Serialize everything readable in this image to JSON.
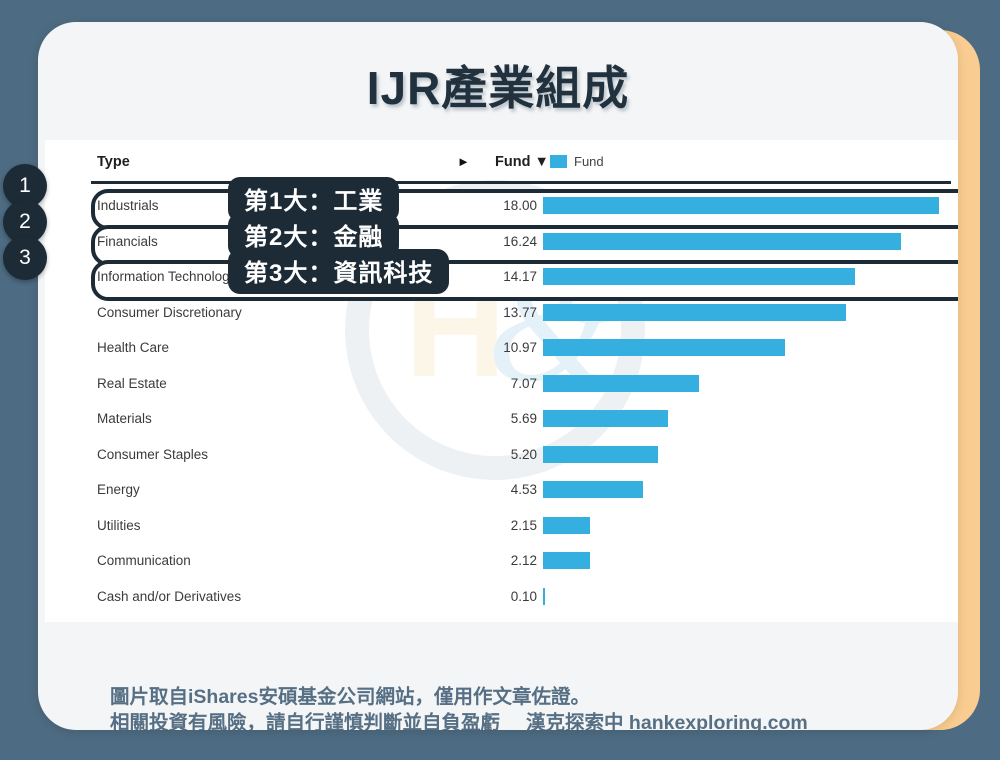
{
  "title": "IJR產業組成",
  "colors": {
    "background": "#4d6b82",
    "accent_strip": "#f9cd91",
    "card": "#f4f5f6",
    "bar": "#35aee0",
    "dark": "#1d2b36",
    "footer_text": "#566f84"
  },
  "table": {
    "col_type_label": "Type",
    "col_fund_label": "Fund ▼",
    "sort_caret": "►",
    "legend_label": "Fund"
  },
  "badges": [
    {
      "number": "1"
    },
    {
      "number": "2"
    },
    {
      "number": "3"
    }
  ],
  "callouts": [
    {
      "text": "第1大：工業"
    },
    {
      "text": "第2大：金融"
    },
    {
      "text": "第3大：資訊科技"
    }
  ],
  "footer": {
    "line1": "圖片取自iShares安碩基金公司網站，僅用作文章佐證。",
    "line2": "相關投資有風險，請自行謹慎判斷並自負盈虧",
    "brand": "漢克探索中 hankexploring.com"
  },
  "watermark": {
    "letter": "H",
    "ampersand": "&"
  },
  "chart_data": {
    "type": "bar",
    "orientation": "horizontal",
    "title": "IJR產業組成",
    "xlabel": "",
    "ylabel": "Type",
    "legend": [
      "Fund"
    ],
    "legend_position": "top-right",
    "grid": false,
    "xlim": [
      0,
      18.3
    ],
    "categories": [
      "Industrials",
      "Financials",
      "Information Technology",
      "Consumer Discretionary",
      "Health Care",
      "Real Estate",
      "Materials",
      "Consumer Staples",
      "Energy",
      "Utilities",
      "Communication",
      "Cash and/or Derivatives"
    ],
    "values": [
      18.0,
      16.24,
      14.17,
      13.77,
      10.97,
      7.07,
      5.69,
      5.2,
      4.53,
      2.15,
      2.12,
      0.1
    ],
    "value_labels": [
      "18.00",
      "16.24",
      "14.17",
      "13.77",
      "10.97",
      "7.07",
      "5.69",
      "5.20",
      "4.53",
      "2.15",
      "2.12",
      "0.10"
    ],
    "highlighted": [
      0,
      1,
      2
    ],
    "series": [
      {
        "name": "Fund",
        "values": [
          18.0,
          16.24,
          14.17,
          13.77,
          10.97,
          7.07,
          5.69,
          5.2,
          4.53,
          2.15,
          2.12,
          0.1
        ]
      }
    ]
  }
}
